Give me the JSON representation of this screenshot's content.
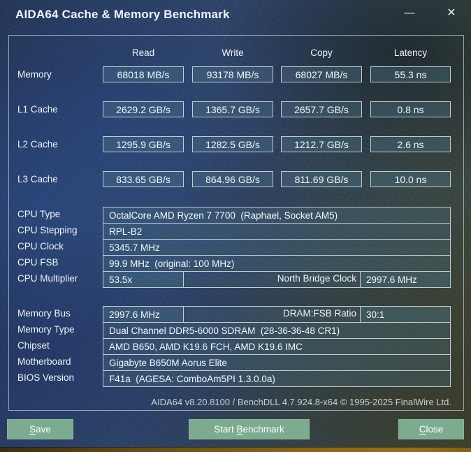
{
  "window": {
    "title": "AIDA64 Cache & Memory Benchmark"
  },
  "icons": {
    "minimize": "—",
    "close": "✕"
  },
  "benchmark": {
    "columns": [
      "Read",
      "Write",
      "Copy",
      "Latency"
    ],
    "rows": [
      {
        "label": "Memory",
        "values": [
          "68018 MB/s",
          "93178 MB/s",
          "68027 MB/s",
          "55.3 ns"
        ]
      },
      {
        "label": "L1 Cache",
        "values": [
          "2629.2 GB/s",
          "1365.7 GB/s",
          "2657.7 GB/s",
          "0.8 ns"
        ]
      },
      {
        "label": "L2 Cache",
        "values": [
          "1295.9 GB/s",
          "1282.5 GB/s",
          "1212.7 GB/s",
          "2.6 ns"
        ]
      },
      {
        "label": "L3 Cache",
        "values": [
          "833.65 GB/s",
          "864.96 GB/s",
          "811.69 GB/s",
          "10.0 ns"
        ]
      }
    ]
  },
  "cpu_info": {
    "rows": [
      {
        "label": "CPU Type",
        "value": "OctalCore AMD Ryzen 7 7700  (Raphael, Socket AM5)"
      },
      {
        "label": "CPU Stepping",
        "value": "RPL-B2"
      },
      {
        "label": "CPU Clock",
        "value": "5345.7 MHz"
      },
      {
        "label": "CPU FSB",
        "value": "99.9 MHz  (original: 100 MHz)"
      },
      {
        "label": "CPU Multiplier",
        "value": "53.5x",
        "extra_label": "North Bridge Clock",
        "extra_value": "2997.6 MHz"
      }
    ]
  },
  "board_info": {
    "rows": [
      {
        "label": "Memory Bus",
        "value": "2997.6 MHz",
        "extra_label": "DRAM:FSB Ratio",
        "extra_value": "30:1"
      },
      {
        "label": "Memory Type",
        "value": "Dual Channel DDR5-6000 SDRAM  (28-36-36-48 CR1)"
      },
      {
        "label": "Chipset",
        "value": "AMD B650, AMD K19.6 FCH, AMD K19.6 IMC"
      },
      {
        "label": "Motherboard",
        "value": "Gigabyte B650M Aorus Elite"
      },
      {
        "label": "BIOS Version",
        "value": "F41a  (AGESA: ComboAm5PI 1.3.0.0a)"
      }
    ]
  },
  "footer": {
    "version_text": "AIDA64 v8.20.8100 / BenchDLL 4.7.924.8-x64 © 1995-2025 FinalWire Ltd."
  },
  "buttons": {
    "save": {
      "prefix": "",
      "accel": "S",
      "suffix": "ave"
    },
    "start": {
      "prefix": "Start ",
      "accel": "B",
      "suffix": "enchmark"
    },
    "close": {
      "prefix": "",
      "accel": "C",
      "suffix": "lose"
    }
  },
  "colors": {
    "button_green": "#7dab90",
    "bottom_strip_gold": "#87651d",
    "box_border": "#c3ced3"
  }
}
